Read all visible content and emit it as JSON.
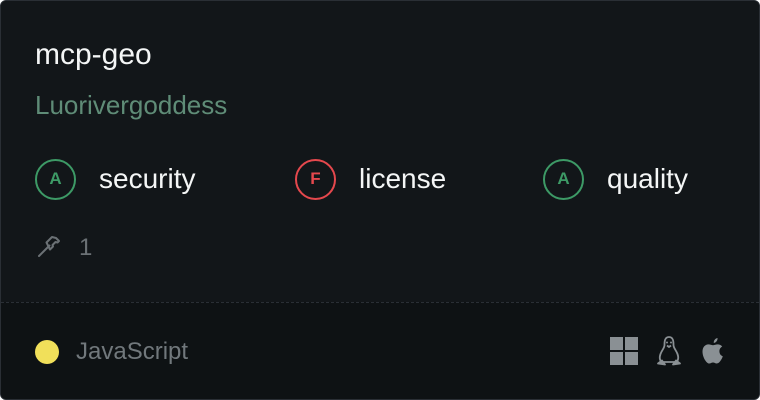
{
  "server": {
    "name": "mcp-geo",
    "author": "Luorivergoddess"
  },
  "scores": [
    {
      "grade": "A",
      "label": "security",
      "status": "pass"
    },
    {
      "grade": "F",
      "label": "license",
      "status": "fail"
    },
    {
      "grade": "A",
      "label": "quality",
      "status": "pass"
    }
  ],
  "tools": {
    "icon": "hammer-icon",
    "count": "1"
  },
  "language": {
    "name": "JavaScript",
    "color": "#f1e05a"
  },
  "platforms": [
    {
      "name": "windows",
      "icon": "windows-icon"
    },
    {
      "name": "linux",
      "icon": "linux-icon"
    },
    {
      "name": "macos",
      "icon": "apple-icon"
    }
  ],
  "colors": {
    "background": "#121619",
    "footer_background": "#0e1214",
    "pass": "#3d9a66",
    "fail": "#e5484d",
    "author": "#5f8c77",
    "muted": "#6b7175"
  }
}
